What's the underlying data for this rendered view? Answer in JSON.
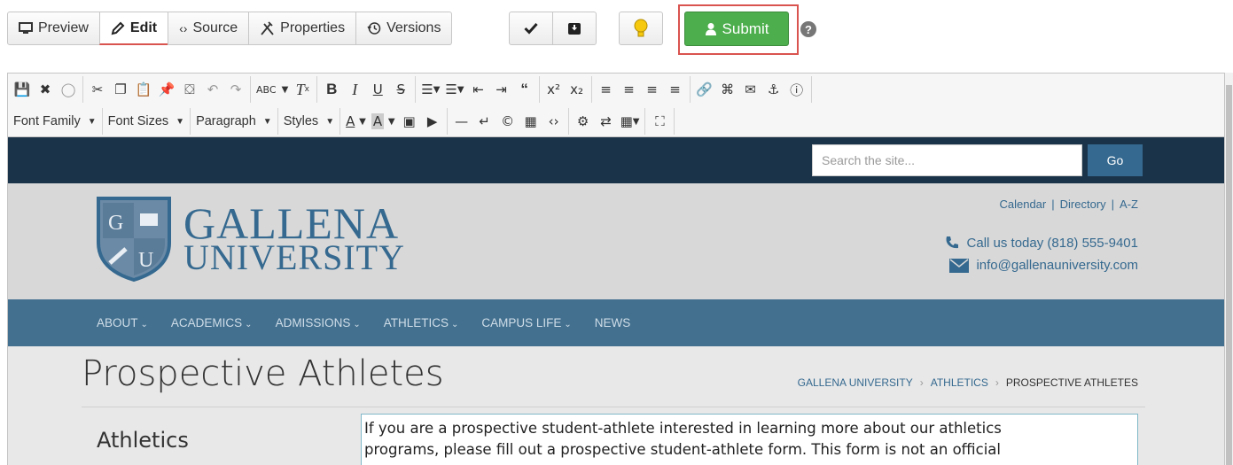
{
  "modebar": {
    "preview": "Preview",
    "edit": "Edit",
    "source": "Source",
    "properties": "Properties",
    "versions": "Versions"
  },
  "actions": {
    "submit": "Submit",
    "help": "?"
  },
  "toolbar": {
    "font_family": "Font Family",
    "font_sizes": "Font Sizes",
    "paragraph": "Paragraph",
    "styles": "Styles"
  },
  "site": {
    "search_placeholder": "Search the site...",
    "go": "Go",
    "logo_line1": "GALLENA",
    "logo_line2": "UNIVERSITY",
    "utility_links": [
      "Calendar",
      "Directory",
      "A-Z"
    ],
    "phone": "Call us today (818) 555-9401",
    "email": "info@gallenauniversity.com",
    "nav": [
      "ABOUT",
      "ACADEMICS",
      "ADMISSIONS",
      "ATHLETICS",
      "CAMPUS LIFE",
      "NEWS"
    ],
    "page_title": "Prospective Athletes",
    "breadcrumbs": [
      "GALLENA UNIVERSITY",
      "ATHLETICS",
      "PROSPECTIVE ATHLETES"
    ],
    "side_title": "Athletics",
    "body_line1": "If you are a prospective student-athlete interested in learning more about our athletics",
    "body_line2": "programs, please fill out a prospective student-athlete form. This form is not an official"
  },
  "colors": {
    "accent_red": "#d9534f",
    "submit_green": "#4cae4c",
    "site_blue": "#35698f",
    "topbar_navy": "#1b3349"
  }
}
